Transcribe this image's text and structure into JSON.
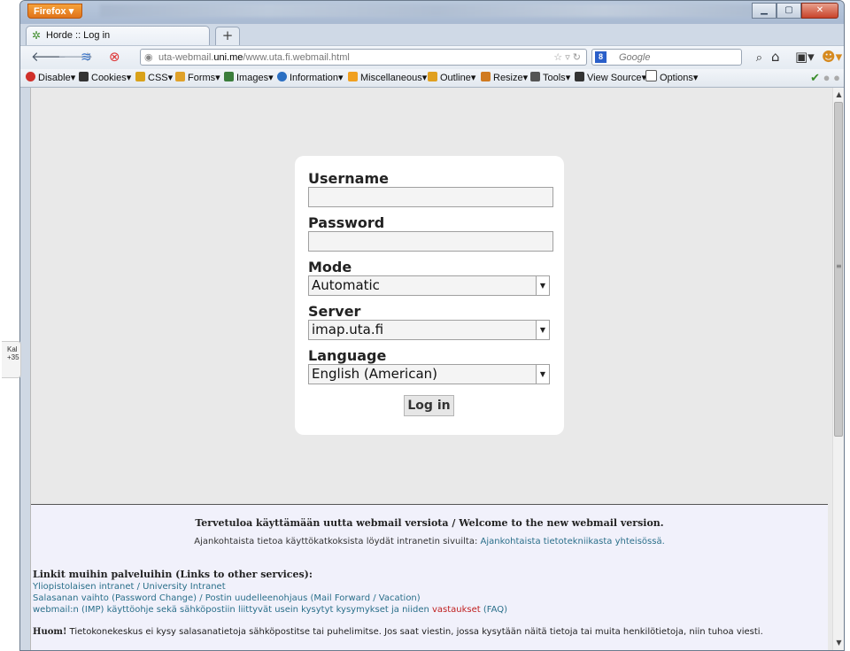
{
  "browser": {
    "app_button": "Firefox",
    "tab_title": "Horde :: Log in",
    "new_tab": "+",
    "url_prefix": "uta-webmail.",
    "url_host": "uni.me",
    "url_path": "/www.uta.fi.webmail.html",
    "search_placeholder": "Google",
    "window_controls": [
      "minimize",
      "maximize",
      "close"
    ]
  },
  "dev_toolbar": {
    "items": [
      "Disable",
      "Cookies",
      "CSS",
      "Forms",
      "Images",
      "Information",
      "Miscellaneous",
      "Outline",
      "Resize",
      "Tools",
      "View Source",
      "Options"
    ],
    "item_colors": [
      "#d0302a",
      "#333333",
      "#d9a21b",
      "#e0a22a",
      "#3b7d3b",
      "#2b6fc2",
      "#f0a020",
      "#e0a020",
      "#d07a20",
      "#555555",
      "#333333",
      "#555555"
    ]
  },
  "side_widget": {
    "line1": "Kal",
    "line2": "+35"
  },
  "login": {
    "username_label": "Username",
    "username_value": "",
    "password_label": "Password",
    "password_value": "",
    "mode_label": "Mode",
    "mode_value": "Automatic",
    "server_label": "Server",
    "server_value": "imap.uta.fi",
    "language_label": "Language",
    "language_value": "English (American)",
    "submit_label": "Log in"
  },
  "footer": {
    "welcome": "Tervetuloa käyttämään uutta webmail versiota / Welcome to the new webmail version.",
    "news_text": "Ajankohtaista tietoa käyttökatkoksista löydät intranetin sivuilta:",
    "news_link": "Ajankohtaista tietotekniikasta yhteisössä.",
    "links_heading": "Linkit muihin palveluihin (Links to other services):",
    "links": [
      "Yliopistolaisen intranet / University Intranet",
      "Salasanan vaihto (Password Change) / Postin uudelleenohjaus (Mail Forward / Vacation)"
    ],
    "faq_text": "webmail:n (IMP) käyttöohje sekä sähköpostiin liittyvät usein kysytyt kysymykset ja niiden",
    "faq_red": "vastaukset",
    "faq_end": "(FAQ)",
    "warn_bold": "Huom!",
    "warn_text": "Tietokonekeskus ei kysy salasanatietoja sähköpostitse tai puhelimitse. Jos saat viestin, jossa kysytään näitä tietoja tai muita henkilötietoja, niin tuhoa viesti."
  }
}
